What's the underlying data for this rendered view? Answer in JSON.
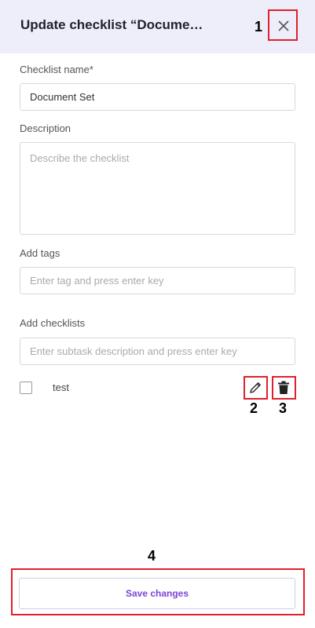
{
  "header": {
    "title": "Update checklist “Docume…",
    "close_icon": "close-icon"
  },
  "form": {
    "name_label": "Checklist name*",
    "name_value": "Document Set",
    "description_label": "Description",
    "description_placeholder": "Describe the checklist",
    "tags_label": "Add tags",
    "tags_placeholder": "Enter tag and press enter key",
    "checklists_label": "Add checklists",
    "checklists_placeholder": "Enter subtask description and press enter key"
  },
  "checklist_items": [
    {
      "text": "test",
      "checked": false,
      "edit_icon": "pencil-icon",
      "delete_icon": "trash-icon"
    }
  ],
  "footer": {
    "save_label": "Save changes"
  },
  "annotations": {
    "a1": "1",
    "a2": "2",
    "a3": "3",
    "a4": "4"
  },
  "colors": {
    "header_bg": "#eeeefb",
    "highlight": "#e0202c",
    "accent": "#7b45d6"
  }
}
